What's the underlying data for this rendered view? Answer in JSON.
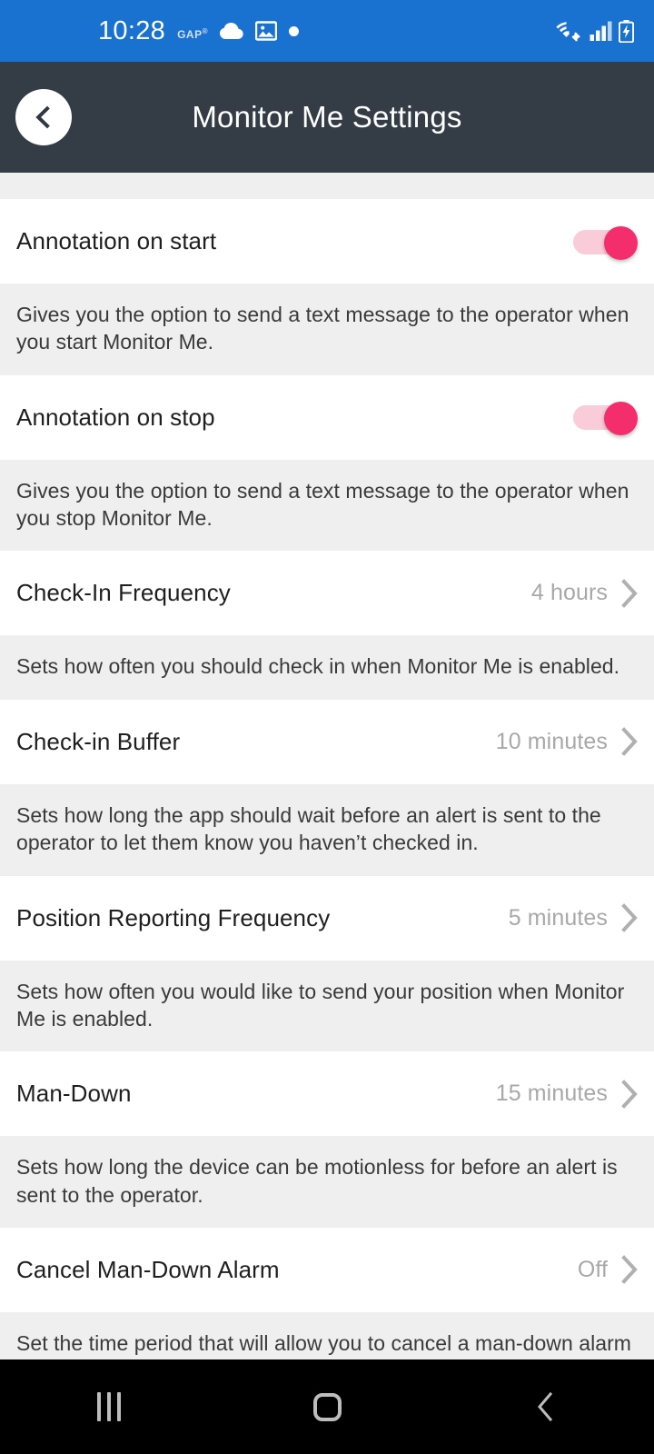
{
  "status_bar": {
    "time": "10:28",
    "brand_badge": "GAP",
    "brand_badge_mark": "®",
    "icons": [
      "gap-badge",
      "cloud-icon",
      "photo-icon",
      "dot-icon",
      "wifi-icon",
      "cellular-signal-icon",
      "battery-charging-icon"
    ],
    "background_color": "#1a72d0"
  },
  "app_bar": {
    "title": "Monitor Me Settings",
    "back_icon": "chevron-left-icon",
    "background_color": "#343d46"
  },
  "settings": {
    "rows": [
      {
        "type": "toggle",
        "label": "Annotation on start",
        "toggle_on": true,
        "description": "Gives you the option to send a text message to the operator when you start Monitor Me."
      },
      {
        "type": "toggle",
        "label": "Annotation on stop",
        "toggle_on": true,
        "description": "Gives you the option to send a text message to the operator when you stop Monitor Me."
      },
      {
        "type": "value",
        "label": "Check-In Frequency",
        "value": "4 hours",
        "description": "Sets how often you should check in when Monitor Me is enabled."
      },
      {
        "type": "value",
        "label": "Check-in Buffer",
        "value": "10 minutes",
        "description": "Sets how long the app should wait before an alert is sent to the operator to let them know you haven’t checked in."
      },
      {
        "type": "value",
        "label": "Position Reporting Frequency",
        "value": "5 minutes",
        "description": "Sets how often you would like to send your position when Monitor Me is enabled."
      },
      {
        "type": "value",
        "label": "Man-Down",
        "value": "15 minutes",
        "description": "Sets how long the device can be motionless for before an alert is sent to the operator."
      },
      {
        "type": "value",
        "label": "Cancel Man-Down Alarm",
        "value": "Off",
        "description": "Set the time period that will allow you to cancel a man-down alarm if no motion is detected."
      }
    ],
    "chevron_icon": "chevron-right-icon",
    "toggle_track_color": "#facbd9",
    "toggle_thumb_color": "#f42e6d",
    "row_background": "#ffffff",
    "description_background": "#efefef"
  },
  "nav_bar": {
    "buttons": [
      {
        "name": "recents-button",
        "icon": "recents-icon"
      },
      {
        "name": "home-button",
        "icon": "home-icon"
      },
      {
        "name": "back-button",
        "icon": "chevron-left-icon"
      }
    ],
    "background_color": "#000000"
  }
}
